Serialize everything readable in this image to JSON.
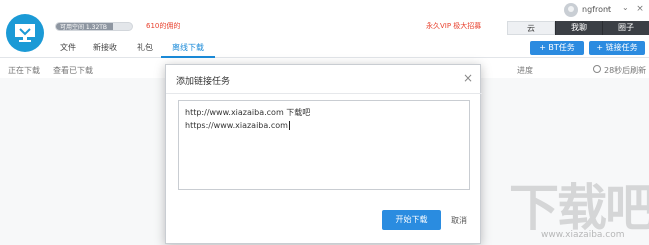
{
  "header": {
    "storage_text": "可用空间 1.32TB",
    "storage_fraction": 0.75,
    "storage_link": "610的佣的",
    "vip_link": "永久VIP 极大招募",
    "username": "ngfront",
    "top_tabs": [
      "云",
      "我聊",
      "圈子"
    ]
  },
  "nav": {
    "tabs": [
      "文件",
      "新接收",
      "礼包",
      "离线下载"
    ],
    "active_tab": "离线下载",
    "bt_button": "+ BT任务",
    "link_button": "+ 链接任务"
  },
  "columns": {
    "downloading": "正在下载",
    "downloaded": "查看已下载",
    "progress": "进度",
    "refresh": "28秒后刷新"
  },
  "dialog": {
    "title": "添加链接任务",
    "lines": [
      "http://www.xiazaiba.com 下载吧",
      "https://www.xiazaiba.com"
    ],
    "start_button": "开始下载",
    "cancel": "取消"
  },
  "watermark": {
    "big": "下载吧",
    "small": "www.xiazaiba.com"
  },
  "colors": {
    "accent": "#1a8ad8",
    "logo": "#1b9ad6",
    "red_link": "#e8422f",
    "dark_tab": "#3b3f45"
  }
}
